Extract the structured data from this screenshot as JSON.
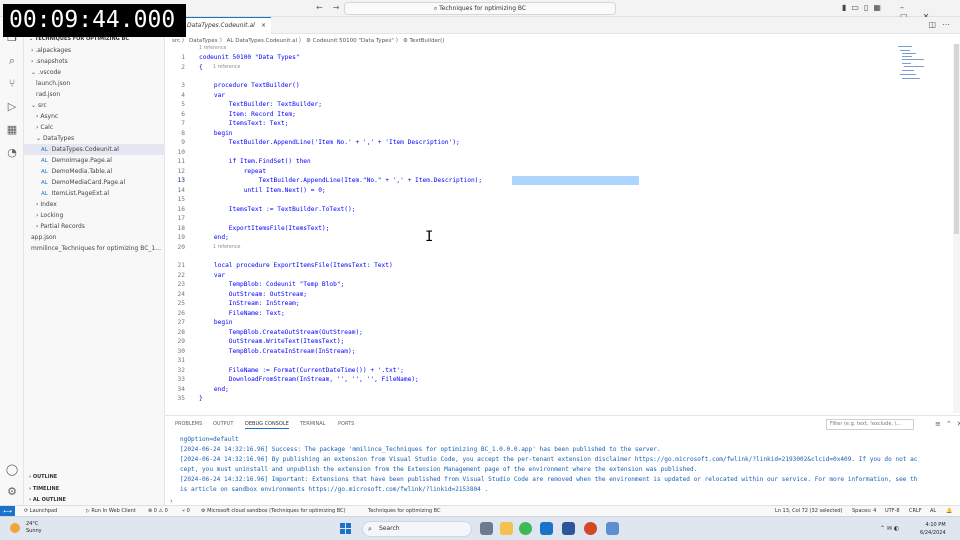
{
  "timer": "00:09:44.000",
  "titlebar": {
    "command_center": "Techniques for optimizing BC"
  },
  "explorer": {
    "header": "TECHNIQUES FOR OPTIMIZING BC",
    "items": [
      {
        "label": ".alpackages",
        "prefix": "›",
        "indent": 1
      },
      {
        "label": ".snapshots",
        "prefix": "›",
        "indent": 1
      },
      {
        "label": ".vscode",
        "prefix": "⌄",
        "indent": 1
      },
      {
        "label": "launch.json",
        "prefix": "",
        "indent": 2
      },
      {
        "label": "rad.json",
        "prefix": "",
        "indent": 2
      },
      {
        "label": "src",
        "prefix": "⌄",
        "indent": 1
      },
      {
        "label": "Async",
        "prefix": "›",
        "indent": 2
      },
      {
        "label": "Calc",
        "prefix": "›",
        "indent": 2
      },
      {
        "label": "DataTypes",
        "prefix": "⌄",
        "indent": 2
      },
      {
        "label": "DataTypes.Codeunit.al",
        "prefix": "AL",
        "indent": 3,
        "selected": true
      },
      {
        "label": "DemoImage.Page.al",
        "prefix": "AL",
        "indent": 3
      },
      {
        "label": "DemoMedia.Table.al",
        "prefix": "AL",
        "indent": 3
      },
      {
        "label": "DemoMediaCard.Page.al",
        "prefix": "AL",
        "indent": 3
      },
      {
        "label": "ItemList.PageExt.al",
        "prefix": "AL",
        "indent": 3
      },
      {
        "label": "Index",
        "prefix": "›",
        "indent": 2
      },
      {
        "label": "Locking",
        "prefix": "›",
        "indent": 2
      },
      {
        "label": "Partial Records",
        "prefix": "›",
        "indent": 2
      },
      {
        "label": "app.json",
        "prefix": "",
        "indent": 1
      },
      {
        "label": "mmilince_Techniques for optimizing BC_1...",
        "prefix": "",
        "indent": 1
      }
    ],
    "bottom_sections": [
      "OUTLINE",
      "TIMELINE",
      "AL OUTLINE"
    ]
  },
  "tab": {
    "label": "DataTypes.Codeunit.al",
    "close": "×"
  },
  "breadcrumb": "src 〉 DataTypes 〉 AL DataTypes.Codeunit.al 〉 ⚙ Codeunit 50100 \"Data Types\" 〉 ⚙ TextBuilder()",
  "code": {
    "lens": [
      {
        "text": "1 reference",
        "before_line": 1
      },
      {
        "text": "1 reference",
        "before_line": 3
      },
      {
        "text": "1 reference",
        "before_line": 21
      }
    ],
    "lines": [
      {
        "n": "1",
        "text": "codeunit 50100 \"Data Types\""
      },
      {
        "n": "2",
        "text": "{"
      },
      {
        "n": "3",
        "text": "    procedure TextBuilder()"
      },
      {
        "n": "4",
        "text": "    var"
      },
      {
        "n": "5",
        "text": "        TextBuilder: TextBuilder;"
      },
      {
        "n": "6",
        "text": "        Item: Record Item;"
      },
      {
        "n": "7",
        "text": "        ItemsText: Text;"
      },
      {
        "n": "8",
        "text": "    begin"
      },
      {
        "n": "9",
        "text": "        TextBuilder.AppendLine('Item No.' + ',' + 'Item Description');"
      },
      {
        "n": "10",
        "text": ""
      },
      {
        "n": "11",
        "text": "        if Item.FindSet() then"
      },
      {
        "n": "12",
        "text": "            repeat"
      },
      {
        "n": "13",
        "text": "                TextBuilder.AppendLine(Item.\"No.\" + ',' + Item.Description);"
      },
      {
        "n": "14",
        "text": "            until Item.Next() = 0;"
      },
      {
        "n": "15",
        "text": ""
      },
      {
        "n": "16",
        "text": "        ItemsText := TextBuilder.ToText();"
      },
      {
        "n": "17",
        "text": ""
      },
      {
        "n": "18",
        "text": "        ExportItemsFile(ItemsText);"
      },
      {
        "n": "19",
        "text": "    end;"
      },
      {
        "n": "20",
        "text": ""
      },
      {
        "n": "21",
        "text": "    local procedure ExportItemsFile(ItemsText: Text)"
      },
      {
        "n": "22",
        "text": "    var"
      },
      {
        "n": "23",
        "text": "        TempBlob: Codeunit \"Temp Blob\";"
      },
      {
        "n": "24",
        "text": "        OutStream: OutStream;"
      },
      {
        "n": "25",
        "text": "        InStream: InStream;"
      },
      {
        "n": "26",
        "text": "        FileName: Text;"
      },
      {
        "n": "27",
        "text": "    begin"
      },
      {
        "n": "28",
        "text": "        TempBlob.CreateOutStream(OutStream);"
      },
      {
        "n": "29",
        "text": "        OutStream.WriteText(ItemsText);"
      },
      {
        "n": "30",
        "text": "        TempBlob.CreateInStream(InStream);"
      },
      {
        "n": "31",
        "text": ""
      },
      {
        "n": "32",
        "text": "        FileName := Format(CurrentDateTime()) + '.txt';"
      },
      {
        "n": "33",
        "text": "        DownloadFromStream(InStream, '', '', '', FileName);"
      },
      {
        "n": "34",
        "text": "    end;"
      },
      {
        "n": "35",
        "text": "}"
      }
    ]
  },
  "panel": {
    "tabs": [
      "PROBLEMS",
      "OUTPUT",
      "DEBUG CONSOLE",
      "TERMINAL",
      "PORTS"
    ],
    "active_tab": "DEBUG CONSOLE",
    "filter_placeholder": "Filter (e.g. text, !exclude, \\...",
    "console": [
      "ngOption=default",
      "[2024-06-24 14:32:16.96] Success: The package 'mmilince_Techniques for optimizing BC_1.0.0.0.app' has been published to the server.",
      "[2024-06-24 14:32:16.96] By publishing an extension from Visual Studio Code, you accept the per-tenant extension disclaimer https://go.microsoft.com/fwlink/?linkid=2193002&clcid=0x409. If you do not ac",
      "cept, you must uninstall and unpublish the extension from the Extension Management page of the environment where the extension was published.",
      "[2024-06-24 14:32:16.96] Important: Extensions that have been published from Visual Studio Code are removed when the environment is updated or relocated within our service. For more information, see th",
      "is article on sandbox environments https://go.microsoft.com/fwlink/?linkid=2153804 ."
    ]
  },
  "statusbar": {
    "left": [
      "⟳ Launchpad",
      "▷ Run In Web Client",
      "⊗ 0 ⚠ 0",
      "⑂ 0",
      "⚙ Microsoft cloud sandbox (Techniques for optimizing BC)",
      "Techniques for optimizing BC"
    ],
    "right": [
      "Ln 13, Col 72 (32 selected)",
      "Spaces: 4",
      "UTF-8",
      "CRLF",
      "AL",
      "🔔"
    ]
  },
  "taskbar": {
    "temperature": "24°C",
    "condition": "Sunny",
    "search_label": "Search",
    "time": "4:10 PM",
    "date": "6/24/2024"
  },
  "colors": {
    "accent": "#1a73c8",
    "keyword": "#0000ff",
    "selection": "#add6ff"
  }
}
